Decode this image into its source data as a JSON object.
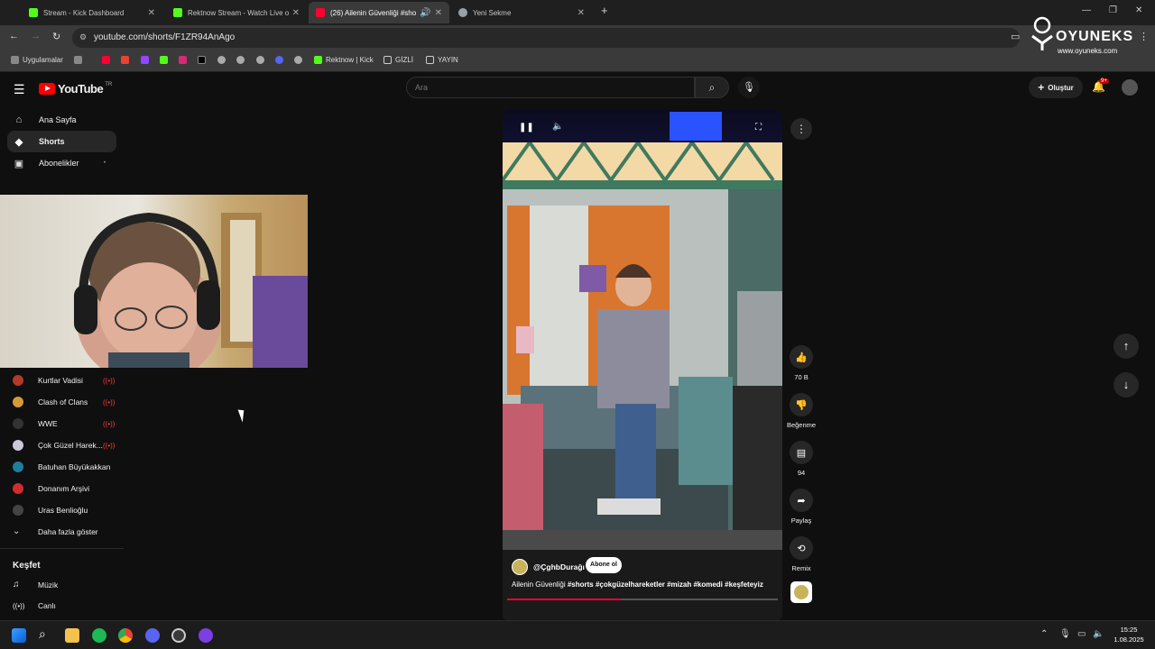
{
  "browser": {
    "tabs": [
      {
        "title": "Stream - Kick Dashboard",
        "favicon_color": "#53fc18",
        "active": false
      },
      {
        "title": "Rektnow Stream - Watch Live o",
        "favicon_color": "#53fc18",
        "active": false
      },
      {
        "title": "(26) Ailenin Güvenliği #shor",
        "favicon_color": "#ff0033",
        "active": true
      },
      {
        "title": "Yeni Sekme",
        "favicon_color": "#9aa0a6",
        "active": false
      }
    ],
    "url": "youtube.com/shorts/F1ZR94AnAgo",
    "bookmarks": {
      "apps_label": "Uygulamalar",
      "kick_label": "Rektnow | Kick",
      "folder1": "GİZLİ",
      "folder2": "YAYIN"
    }
  },
  "watermark": {
    "brand": "OYUNEKS",
    "site": "www.oyuneks.com"
  },
  "youtube": {
    "logo_text": "YouTube",
    "country_code": "TR",
    "search_placeholder": "Ara",
    "create_label": "Oluştur",
    "notification_count": "9+",
    "sidebar": [
      {
        "label": "Ana Sayfa",
        "icon": "home-icon"
      },
      {
        "label": "Shorts",
        "icon": "shorts-icon"
      },
      {
        "label": "Abonelikler",
        "icon": "subscriptions-icon"
      }
    ],
    "subscriptions": [
      {
        "label": "Kurtlar Vadisi",
        "avatar_color": "#b33a2a",
        "live": true
      },
      {
        "label": "Clash of Clans",
        "avatar_color": "#d79a32",
        "live": true
      },
      {
        "label": "WWE",
        "avatar_color": "#333333",
        "live": true
      },
      {
        "label": "Çok Güzel Harek...",
        "avatar_color": "#c9c9d9",
        "live": true
      },
      {
        "label": "Batuhan Büyükakkan",
        "avatar_color": "#1d7f9a",
        "live": false
      },
      {
        "label": "Donanım Arşivi",
        "avatar_color": "#d22b2b",
        "live": false
      },
      {
        "label": "Uras Benlioğlu",
        "avatar_color": "#444444",
        "live": false
      }
    ],
    "show_more_label": "Daha fazla göster",
    "explore_heading": "Keşfet",
    "explore": [
      {
        "label": "Müzik",
        "icon": "music-icon"
      },
      {
        "label": "Canlı",
        "icon": "live-icon"
      }
    ],
    "short": {
      "channel": "@ÇghbDurağı",
      "subscribe_label": "Abone ol",
      "caption_title": "Ailenin Güvenliği",
      "caption_tags": "#shorts  #çokgüzelhareketler #mizah #komedi #keşfeteyiz",
      "progress": 0.42
    },
    "actions": [
      {
        "icon": "like-icon",
        "label": "70 B"
      },
      {
        "icon": "dislike-icon",
        "label": "Beğenme"
      },
      {
        "icon": "comment-icon",
        "label": "94"
      },
      {
        "icon": "share-icon",
        "label": "Paylaş"
      },
      {
        "icon": "remix-icon",
        "label": "Remix"
      }
    ]
  },
  "taskbar": {
    "time": "15:25",
    "date": "1.08.2025"
  }
}
